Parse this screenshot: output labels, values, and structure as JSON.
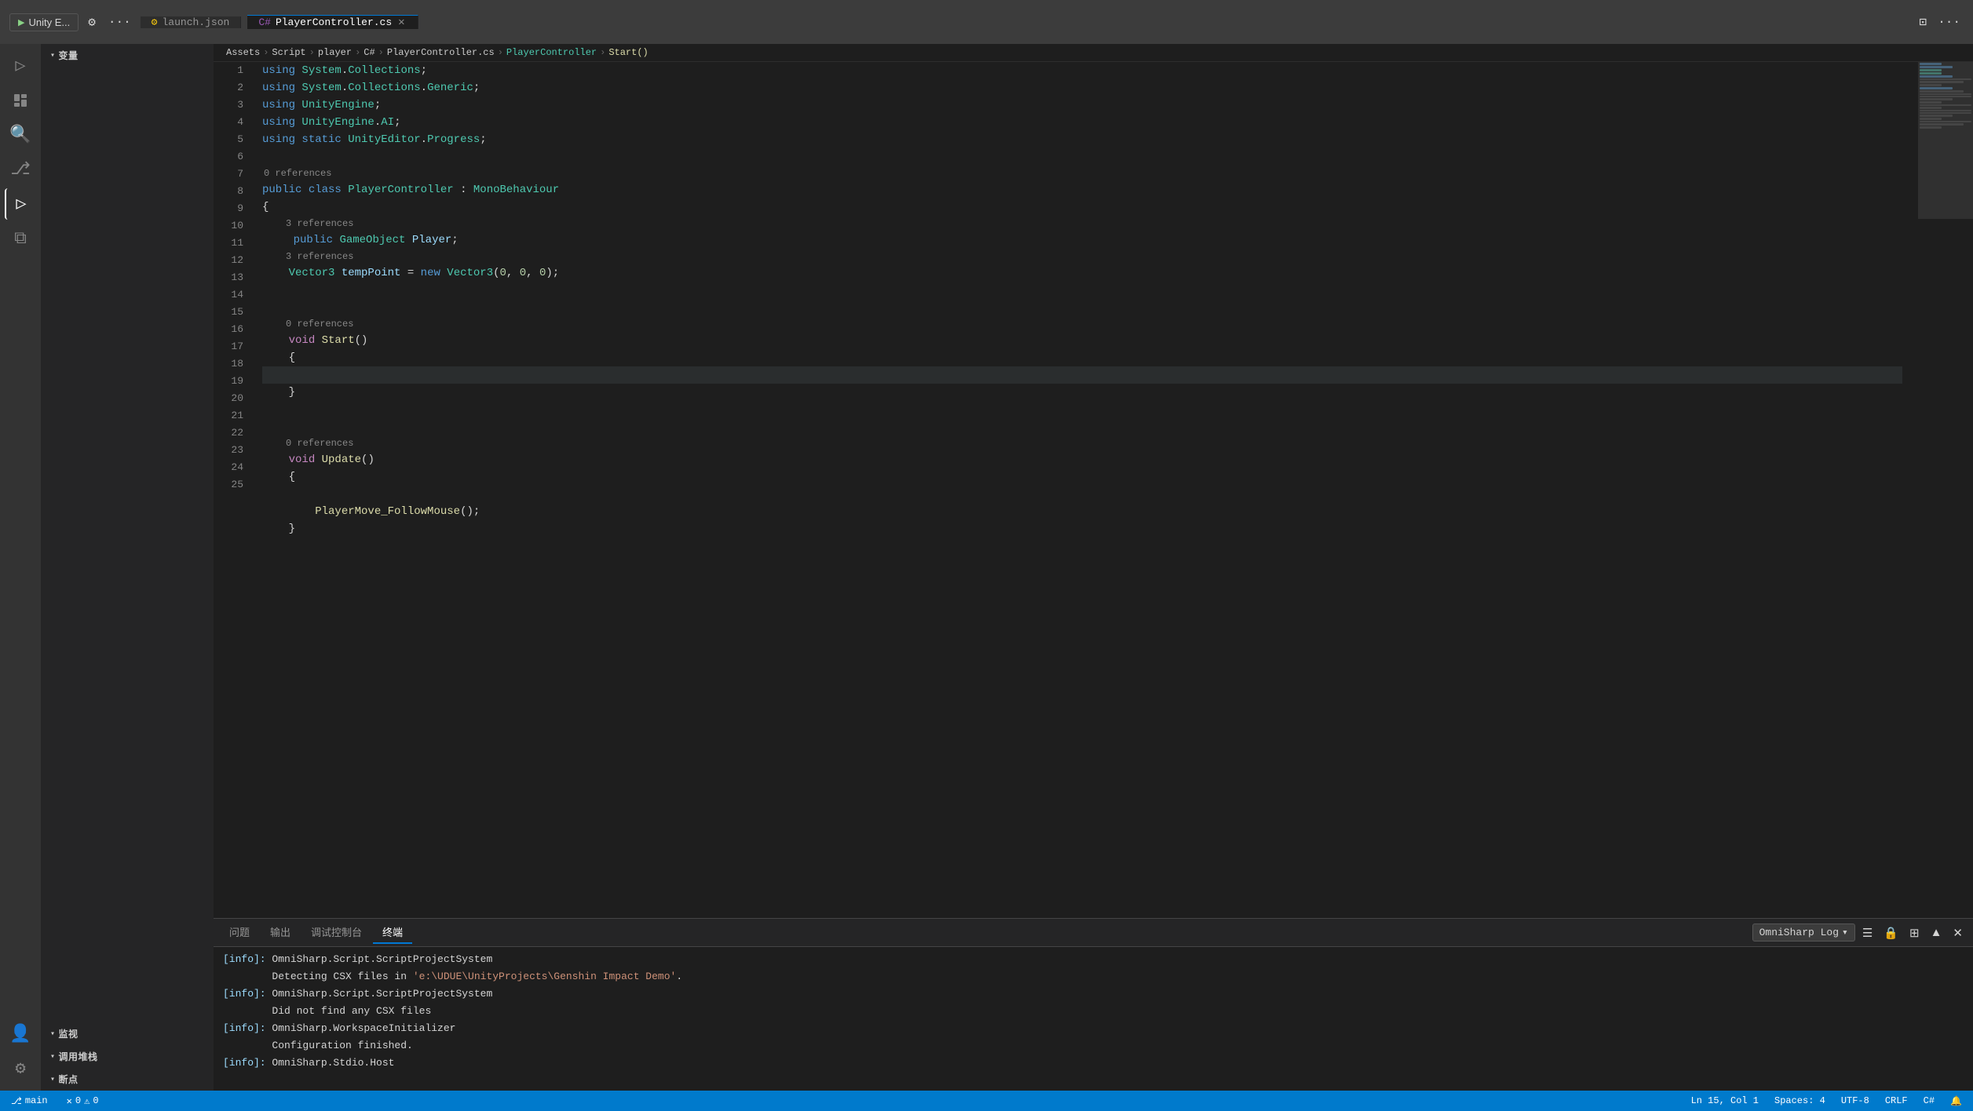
{
  "titlebar": {
    "run_label": "Unity E...",
    "gear_icon": "⚙",
    "ellipsis_icon": "···",
    "tab_launch": "launch.json",
    "tab_player": "PlayerController.cs",
    "close_icon": "✕",
    "split_icon": "⊡",
    "more_icon": "···"
  },
  "breadcrumb": {
    "assets": "Assets",
    "script": "Script",
    "player": "player",
    "csharp": "C#",
    "file": "PlayerController.cs",
    "class": "PlayerController",
    "method": "Start()"
  },
  "sidebar": {
    "variables_label": "变量",
    "watch_label": "监视",
    "callstack_label": "调用堆栈",
    "breakpoints_label": "断点"
  },
  "tabs": {
    "launch": "launch.json",
    "player": "PlayerController.cs"
  },
  "code": {
    "lines": [
      {
        "num": 1,
        "text": "using System.Collections;"
      },
      {
        "num": 2,
        "text": "using System.Collections.Generic;"
      },
      {
        "num": 3,
        "text": "using UnityEngine;"
      },
      {
        "num": 4,
        "text": "using UnityEngine.AI;"
      },
      {
        "num": 5,
        "text": "using static UnityEditor.Progress;"
      },
      {
        "num": 6,
        "text": ""
      },
      {
        "num": 7,
        "text": "public class PlayerController : MonoBehaviour"
      },
      {
        "num": 8,
        "text": "{"
      },
      {
        "num": 9,
        "text": "    public GameObject Player;"
      },
      {
        "num": 10,
        "text": "    Vector3 tempPoint = new Vector3(0, 0, 0);"
      },
      {
        "num": 11,
        "text": ""
      },
      {
        "num": 12,
        "text": ""
      },
      {
        "num": 13,
        "text": "    void Start()"
      },
      {
        "num": 14,
        "text": "    {"
      },
      {
        "num": 15,
        "text": ""
      },
      {
        "num": 16,
        "text": "    }"
      },
      {
        "num": 17,
        "text": ""
      },
      {
        "num": 18,
        "text": ""
      },
      {
        "num": 19,
        "text": "    void Update()"
      },
      {
        "num": 20,
        "text": "    {"
      },
      {
        "num": 21,
        "text": ""
      },
      {
        "num": 22,
        "text": "        PlayerMove_FollowMouse();"
      },
      {
        "num": 23,
        "text": "    }"
      },
      {
        "num": 24,
        "text": ""
      },
      {
        "num": 25,
        "text": ""
      }
    ]
  },
  "panel": {
    "tabs": [
      "问题",
      "输出",
      "调试控制台",
      "终端"
    ],
    "active_tab": "输出",
    "dropdown_label": "OmniSharp Log",
    "log_lines": [
      "[info]: OmniSharp.Script.ScriptProjectSystem",
      "        Detecting CSX files in 'e:\\UDUE\\UnityProjects\\Genshin Impact Demo'.",
      "[info]: OmniSharp.Script.ScriptProjectSystem",
      "        Did not find any CSX files",
      "[info]: OmniSharp.WorkspaceInitializer",
      "        Configuration finished.",
      "[info]: OmniSharp.Stdio.Host"
    ]
  },
  "statusbar": {
    "git_icon": "⎇",
    "git_branch": "main",
    "error_icon": "✕",
    "errors": "0",
    "warning_icon": "⚠",
    "warnings": "0",
    "ln_label": "Ln 15, Col 1",
    "spaces_label": "Spaces: 4",
    "encoding_label": "UTF-8",
    "eol_label": "CRLF",
    "lang_label": "C#",
    "bell_icon": "🔔"
  },
  "refs": {
    "zero_ref": "0 references",
    "three_ref": "3 references"
  }
}
